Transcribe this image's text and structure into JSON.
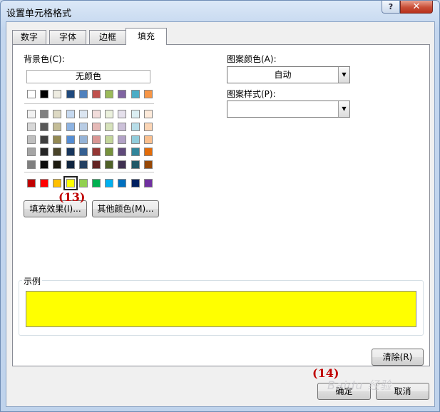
{
  "window": {
    "title": "设置单元格格式",
    "help_label": "?",
    "close_label": "✕"
  },
  "tabs": [
    {
      "label": "数字",
      "active": false
    },
    {
      "label": "字体",
      "active": false
    },
    {
      "label": "边框",
      "active": false
    },
    {
      "label": "填充",
      "active": true
    }
  ],
  "background": {
    "label": "背景色(C):",
    "no_color_label": "无颜色",
    "theme_row": [
      "#ffffff",
      "#000000",
      "#eeece1",
      "#1f497d",
      "#4f81bd",
      "#c0504d",
      "#9bbb59",
      "#8064a2",
      "#4bacc6",
      "#f79646"
    ],
    "shade_rows": [
      [
        "#f2f2f2",
        "#7f7f7f",
        "#ddd9c3",
        "#c6d9f0",
        "#dbe5f1",
        "#f2dcdb",
        "#ebf1dd",
        "#e5e0ec",
        "#dbeef3",
        "#fdeada"
      ],
      [
        "#d8d8d8",
        "#595959",
        "#c4bd97",
        "#8db3e2",
        "#b8cce4",
        "#e5b9b7",
        "#d7e3bc",
        "#ccc1d9",
        "#b7dde8",
        "#fbd5b5"
      ],
      [
        "#bfbfbf",
        "#3f3f3f",
        "#938953",
        "#548dd4",
        "#95b3d7",
        "#d99694",
        "#c3d69b",
        "#b2a2c7",
        "#92cddc",
        "#fac08f"
      ],
      [
        "#a5a5a5",
        "#262626",
        "#494429",
        "#17365d",
        "#366092",
        "#953734",
        "#76923c",
        "#5f497a",
        "#31859b",
        "#e36c09"
      ],
      [
        "#7f7f7f",
        "#0c0c0c",
        "#1d1b10",
        "#0f243e",
        "#244061",
        "#632423",
        "#4f6128",
        "#3f3151",
        "#205867",
        "#974806"
      ]
    ],
    "standard_row": [
      "#c00000",
      "#ff0000",
      "#ffc000",
      "#ffff00",
      "#92d050",
      "#00b050",
      "#00b0f0",
      "#0070c0",
      "#002060",
      "#7030a0"
    ],
    "selected_standard_index": 3,
    "fill_effects_label": "填充效果(I)...",
    "more_colors_label": "其他颜色(M)..."
  },
  "pattern": {
    "color_label": "图案颜色(A):",
    "color_value": "自动",
    "style_label": "图案样式(P):",
    "style_value": ""
  },
  "sample": {
    "label": "示例",
    "color": "#ffff00"
  },
  "buttons": {
    "clear_label": "清除(R)",
    "ok_label": "确定",
    "cancel_label": "取消"
  },
  "annotations": {
    "step13": "(13)",
    "step14": "(14)"
  },
  "watermark": "Baidu 经验"
}
